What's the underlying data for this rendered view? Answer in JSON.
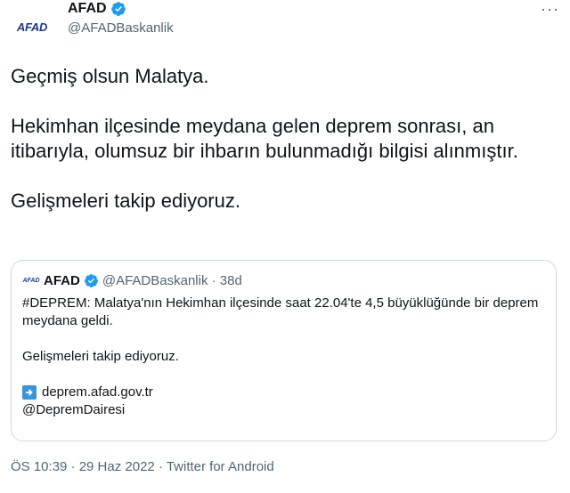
{
  "author": {
    "avatar_text": "AFAD",
    "display_name": "AFAD",
    "handle": "@AFADBaskanlik",
    "more": "···"
  },
  "tweet": {
    "lines": [
      "Geçmiş olsun Malatya.",
      "Hekimhan ilçesinde meydana gelen deprem sonrası, an itibarıyla, olumsuz bir ihbarın bulunmadığı bilgisi alınmıştır.",
      "Gelişmeleri takip ediyoruz."
    ]
  },
  "quote": {
    "avatar_text": "AFAD",
    "display_name": "AFAD",
    "handle_time": "@AFADBaskanlik · 38d",
    "text1": "#DEPREM: Malatya'nın Hekimhan ilçesinde saat 22.04'te 4,5 büyüklüğünde bir deprem meydana geldi.",
    "text2": "Gelişmeleri takip ediyoruz.",
    "link": "deprem.afad.gov.tr",
    "mention": "@DepremDairesi"
  },
  "footer": {
    "meta": "ÖS 10:39 · 29 Haz 2022 · Twitter for Android"
  },
  "colors": {
    "verified": "#1d9bf0",
    "secondary_text": "#536471",
    "border": "#cfd9de",
    "link_arrow": "#3b94d9"
  },
  "icons": {
    "verified": "verified-badge-icon",
    "more": "more-options-icon",
    "link_arrow": "right-arrow-icon"
  }
}
